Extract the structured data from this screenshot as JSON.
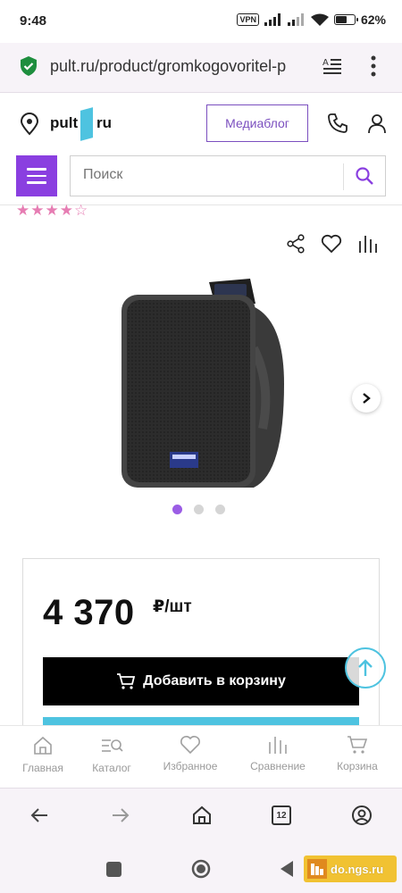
{
  "status": {
    "time": "9:48",
    "vpn": "VPN",
    "battery_level": 0.62,
    "battery": "62%"
  },
  "browser": {
    "url": "pult.ru/product/gromkogovoritel-p",
    "tabs_count": "12"
  },
  "header": {
    "logo_left": "pult",
    "logo_right": "ru",
    "mediablog_label": "Медиаблог",
    "search_placeholder": "Поиск"
  },
  "product": {
    "rating_stars": "★★★★☆",
    "rating_value": 4,
    "rating_max": 5,
    "gallery_total": 3,
    "gallery_active": 1
  },
  "price": {
    "amount": "4 370",
    "unit": "₽/шт",
    "add_to_cart_label": "Добавить в корзину"
  },
  "bottom_nav": {
    "items": [
      {
        "label": "Главная",
        "icon": "home-icon"
      },
      {
        "label": "Каталог",
        "icon": "catalog-icon"
      },
      {
        "label": "Избранное",
        "icon": "heart-icon"
      },
      {
        "label": "Сравнение",
        "icon": "compare-icon"
      },
      {
        "label": "Корзина",
        "icon": "cart-icon"
      }
    ]
  },
  "watermark": {
    "text": "do.ngs.ru"
  },
  "colors": {
    "accent_purple": "#8a3fe0",
    "accent_teal": "#4ec3e0",
    "rating_pink": "#e67db3"
  }
}
